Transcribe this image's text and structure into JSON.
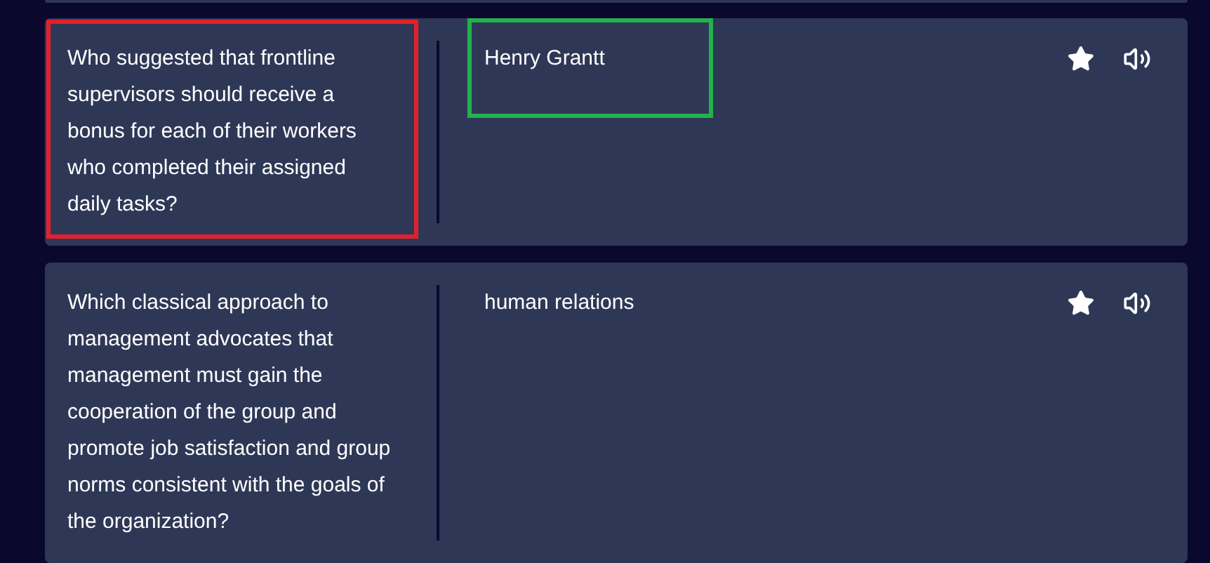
{
  "cards": [
    {
      "term": "Who suggested that frontline supervisors should receive a bonus for each of their workers who completed their assigned daily tasks?",
      "definition": "Henry Grantt",
      "term_marked": true,
      "definition_marked": true
    },
    {
      "term": "Which classical approach to management advocates that management must gain the cooperation of the group and promote job satisfaction and group norms consistent with the goals of the organization?",
      "definition": "human relations",
      "term_marked": false,
      "definition_marked": false
    }
  ]
}
